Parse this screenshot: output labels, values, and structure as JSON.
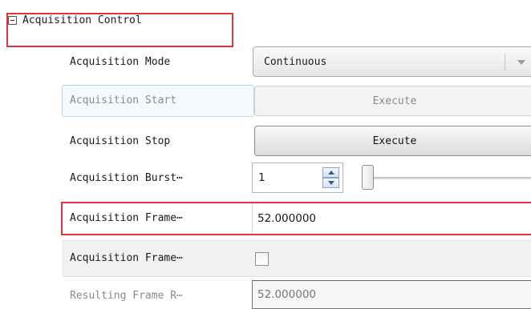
{
  "section": {
    "collapse_icon": "minus-box-icon",
    "title": "Acquisition Control"
  },
  "rows": {
    "mode": {
      "label": "Acquisition Mode",
      "value": "Continuous"
    },
    "start": {
      "label": "Acquisition Start",
      "button": "Execute"
    },
    "stop": {
      "label": "Acquisition Stop",
      "button": "Execute"
    },
    "burst": {
      "label": "Acquisition Burst⋯",
      "value": "1"
    },
    "frame_rate": {
      "label": "Acquisition Frame⋯",
      "value": "52.000000"
    },
    "frame_enable": {
      "label": "Acquisition Frame⋯"
    },
    "resulting": {
      "label": "Resulting Frame R⋯",
      "value": "52.000000"
    }
  },
  "colors": {
    "highlight": "#e0343a"
  }
}
